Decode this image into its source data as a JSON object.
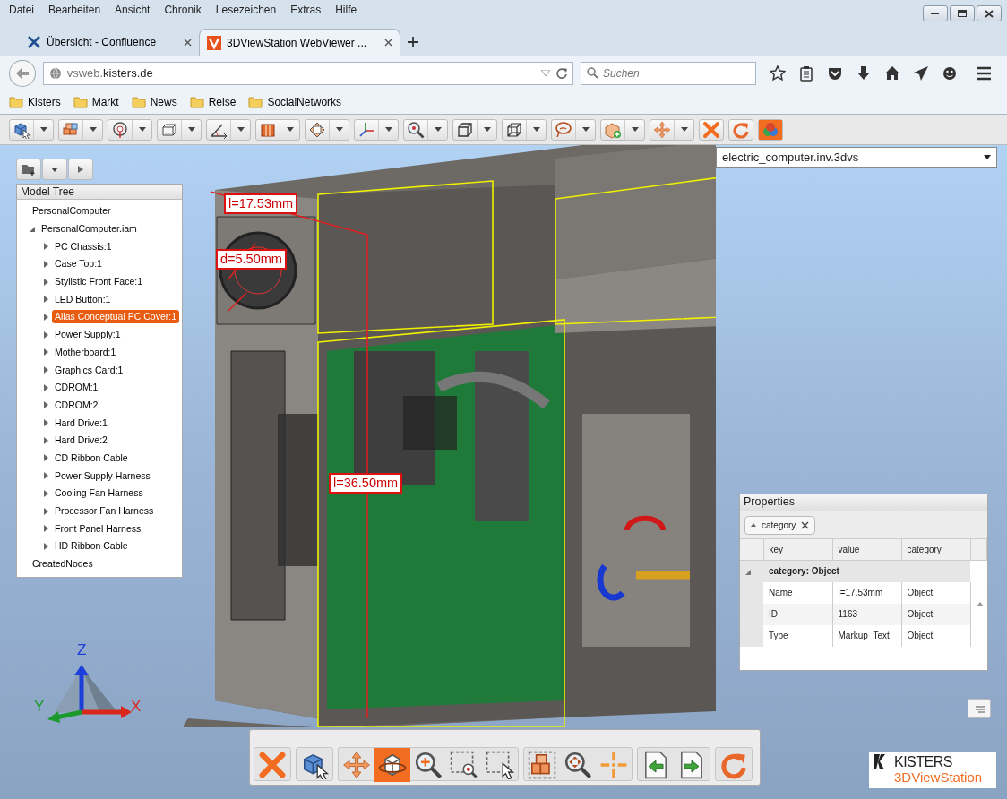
{
  "menu": [
    "Datei",
    "Bearbeiten",
    "Ansicht",
    "Chronik",
    "Lesezeichen",
    "Extras",
    "Hilfe"
  ],
  "tabs": [
    {
      "label": "Übersicht - Confluence",
      "selected": false,
      "kind": "confluence"
    },
    {
      "label": "3DViewStation WebViewer ...",
      "selected": true,
      "kind": "viewstation"
    }
  ],
  "address": {
    "subdomain": "vsweb.",
    "domain": "kisters.de"
  },
  "search": {
    "placeholder": "Suchen"
  },
  "bookmarks": [
    "Kisters",
    "Markt",
    "News",
    "Reise",
    "SocialNetworks"
  ],
  "toolbar": [
    {
      "kind": "select",
      "dropdown": true,
      "active": false
    },
    {
      "kind": "cubes",
      "dropdown": true,
      "active": false
    },
    {
      "kind": "target",
      "dropdown": true,
      "active": false
    },
    {
      "kind": "box",
      "dropdown": true,
      "active": false
    },
    {
      "kind": "angle",
      "dropdown": true,
      "active": false
    },
    {
      "kind": "cut",
      "dropdown": true,
      "active": false
    },
    {
      "kind": "diamond",
      "dropdown": true,
      "active": false
    },
    {
      "kind": "axes",
      "dropdown": true,
      "active": false
    },
    {
      "kind": "zoom",
      "dropdown": true,
      "active": false
    },
    {
      "kind": "wire",
      "dropdown": true,
      "active": false
    },
    {
      "kind": "wire2",
      "dropdown": true,
      "active": false
    },
    {
      "kind": "lasso",
      "dropdown": true,
      "active": false
    },
    {
      "kind": "addpart",
      "dropdown": true,
      "active": false
    },
    {
      "kind": "move",
      "dropdown": true,
      "active": false
    },
    {
      "kind": "close",
      "dropdown": false,
      "active": false
    },
    {
      "kind": "refresh",
      "dropdown": false,
      "active": false
    },
    {
      "kind": "materials",
      "dropdown": false,
      "active": true
    }
  ],
  "file_select": {
    "value": "electric_computer.inv.3dvs"
  },
  "model_tree": {
    "title": "Model Tree",
    "items": [
      {
        "label": "PersonalComputer",
        "selected": false
      },
      {
        "label": "PersonalComputer.iam",
        "selected": false,
        "expanded": true,
        "children": [
          {
            "label": "PC Chassis:1",
            "selected": false,
            "expanded": false
          },
          {
            "label": "Case Top:1",
            "selected": false,
            "expanded": false
          },
          {
            "label": "Stylistic Front Face:1",
            "selected": false,
            "expanded": false
          },
          {
            "label": "LED Button:1",
            "selected": false,
            "expanded": false
          },
          {
            "label": "Alias Conceptual PC Cover:1",
            "selected": true,
            "expanded": false
          },
          {
            "label": "Power Supply:1",
            "selected": false,
            "expanded": false
          },
          {
            "label": "Motherboard:1",
            "selected": false,
            "expanded": false
          },
          {
            "label": "Graphics Card:1",
            "selected": false,
            "expanded": false
          },
          {
            "label": "CDROM:1",
            "selected": false,
            "expanded": false
          },
          {
            "label": "CDROM:2",
            "selected": false,
            "expanded": false
          },
          {
            "label": "Hard Drive:1",
            "selected": false,
            "expanded": false
          },
          {
            "label": "Hard Drive:2",
            "selected": false,
            "expanded": false
          },
          {
            "label": "CD Ribbon Cable",
            "selected": false,
            "expanded": false
          },
          {
            "label": "Power Supply Harness",
            "selected": false,
            "expanded": false
          },
          {
            "label": "Cooling Fan Harness",
            "selected": false,
            "expanded": false
          },
          {
            "label": "Processor Fan Harness",
            "selected": false,
            "expanded": false
          },
          {
            "label": "Front Panel Harness",
            "selected": false,
            "expanded": false
          },
          {
            "label": "HD Ribbon Cable",
            "selected": false,
            "expanded": false
          }
        ]
      },
      {
        "label": "CreatedNodes",
        "selected": false
      }
    ]
  },
  "measurements": [
    "l=17.53mm",
    "d=5.50mm",
    "l=36.50mm"
  ],
  "properties": {
    "title": "Properties",
    "filter": "category",
    "columns": [
      "key",
      "value",
      "category"
    ],
    "group": "category: Object",
    "rows": [
      [
        "Name",
        "l=17.53mm",
        "Object"
      ],
      [
        "ID",
        "1163",
        "Object"
      ],
      [
        "Type",
        "Markup_Text",
        "Object"
      ]
    ]
  },
  "axes": {
    "z": "Z",
    "y": "Y",
    "x": "X"
  },
  "bottom_toolbar": [
    [
      {
        "kind": "close",
        "active": false
      }
    ],
    [
      {
        "kind": "select",
        "active": false
      }
    ],
    [
      {
        "kind": "move",
        "active": false
      },
      {
        "kind": "orbit",
        "active": true
      },
      {
        "kind": "zoomin",
        "active": false
      },
      {
        "kind": "zoomwindow",
        "active": false
      },
      {
        "kind": "selectwindow",
        "active": false
      }
    ],
    [
      {
        "kind": "fitall",
        "active": false
      },
      {
        "kind": "zoomfit",
        "active": false
      },
      {
        "kind": "center",
        "active": false
      }
    ],
    [
      {
        "kind": "prev",
        "active": false
      },
      {
        "kind": "next",
        "active": false
      }
    ],
    [
      {
        "kind": "refresh",
        "active": false
      }
    ]
  ],
  "logo": {
    "company": "KISTERS",
    "product": "3DViewStation"
  }
}
